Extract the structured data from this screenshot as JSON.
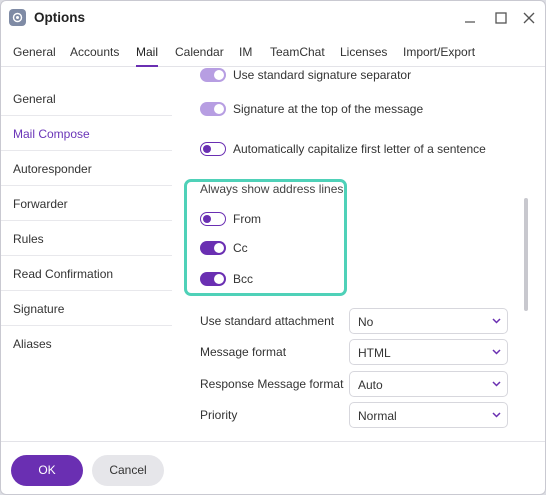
{
  "window": {
    "title": "Options"
  },
  "tabs": [
    {
      "label": "General"
    },
    {
      "label": "Accounts"
    },
    {
      "label": "Mail"
    },
    {
      "label": "Calendar"
    },
    {
      "label": "IM"
    },
    {
      "label": "TeamChat"
    },
    {
      "label": "Licenses"
    },
    {
      "label": "Import/Export"
    }
  ],
  "active_tab": "Mail",
  "sidebar": {
    "items": [
      {
        "label": "General"
      },
      {
        "label": "Mail Compose"
      },
      {
        "label": "Autoresponder"
      },
      {
        "label": "Forwarder"
      },
      {
        "label": "Rules"
      },
      {
        "label": "Read Confirmation"
      },
      {
        "label": "Signature"
      },
      {
        "label": "Aliases"
      }
    ],
    "active": "Mail Compose"
  },
  "settings": {
    "toggles": [
      {
        "label": "Use standard signature separator",
        "state": "on"
      },
      {
        "label": "Signature at the top of the message",
        "state": "on"
      },
      {
        "label": "Automatically capitalize first letter of a sentence",
        "state": "off"
      }
    ],
    "address_lines": {
      "title": "Always show address lines",
      "items": [
        {
          "label": "From",
          "state": "off"
        },
        {
          "label": "Cc",
          "state": "on"
        },
        {
          "label": "Bcc",
          "state": "on"
        }
      ]
    },
    "selects": [
      {
        "label": "Use standard attachment",
        "value": "No"
      },
      {
        "label": "Message format",
        "value": "HTML"
      },
      {
        "label": "Response Message format",
        "value": "Auto"
      },
      {
        "label": "Priority",
        "value": "Normal"
      }
    ]
  },
  "footer": {
    "ok_label": "OK",
    "cancel_label": "Cancel"
  },
  "colors": {
    "accent": "#6a2fb2",
    "highlight": "#4fd1b8",
    "accent_light": "#b79ee2"
  }
}
